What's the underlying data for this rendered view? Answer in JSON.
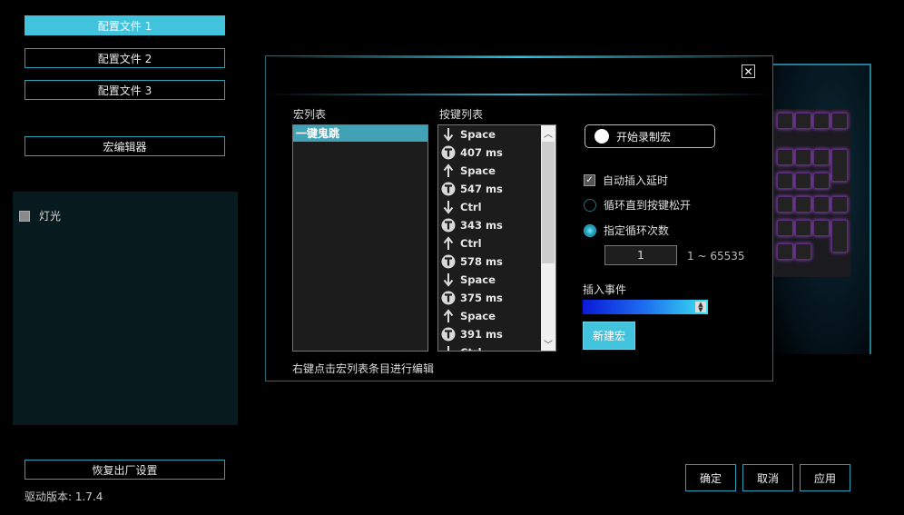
{
  "sidebar": {
    "profiles": [
      "配置文件 1",
      "配置文件 2",
      "配置文件 3"
    ],
    "macro_editor_label": "宏编辑器",
    "lighting_label": "灯光",
    "reset_label": "恢复出厂设置",
    "version_text": "驱动版本:  1.7.4"
  },
  "dialog": {
    "close_glyph": "✕",
    "macro_list_title": "宏列表",
    "key_list_title": "按键列表",
    "macros": [
      "一键鬼跳"
    ],
    "keys": [
      {
        "icon": "down-arrow",
        "label": "Space"
      },
      {
        "icon": "timer",
        "label": "407 ms"
      },
      {
        "icon": "up-arrow",
        "label": "Space"
      },
      {
        "icon": "timer",
        "label": "547 ms"
      },
      {
        "icon": "down-arrow",
        "label": "Ctrl"
      },
      {
        "icon": "timer",
        "label": "343 ms"
      },
      {
        "icon": "up-arrow",
        "label": "Ctrl"
      },
      {
        "icon": "timer",
        "label": "578 ms"
      },
      {
        "icon": "down-arrow",
        "label": "Space"
      },
      {
        "icon": "timer",
        "label": "375 ms"
      },
      {
        "icon": "up-arrow",
        "label": "Space"
      },
      {
        "icon": "timer",
        "label": "391 ms"
      },
      {
        "icon": "down-arrow",
        "label": "Ctrl"
      }
    ],
    "record_label": "开始录制宏",
    "auto_delay_label": "自动插入延时",
    "auto_delay_checked": true,
    "loop_until_release_label": "循环直到按键松开",
    "loop_count_label": "指定循环次数",
    "loop_count_value": "1",
    "loop_range": "1 ~ 65535",
    "insert_event_label": "插入事件",
    "new_macro_label": "新建宏",
    "hint_text": "右键点击宏列表条目进行编辑"
  },
  "footer": {
    "ok_label": "确定",
    "cancel_label": "取消",
    "apply_label": "应用"
  },
  "colors": {
    "accent": "#41c3dd",
    "border": "#2aa3b8"
  }
}
